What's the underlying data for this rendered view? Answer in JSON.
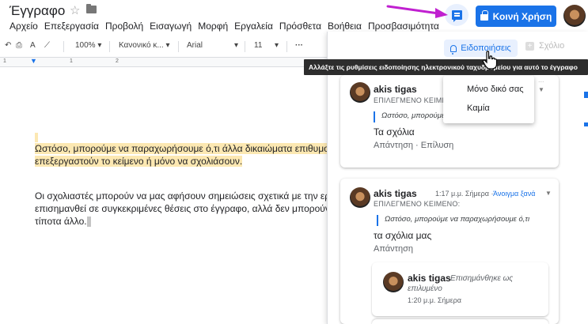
{
  "doc": {
    "title": "Έγγραφο"
  },
  "menu": [
    "Αρχείο",
    "Επεξεργασία",
    "Προβολή",
    "Εισαγωγή",
    "Μορφή",
    "Εργαλεία",
    "Πρόσθετα",
    "Βοήθεια",
    "Προσβασιμότητα"
  ],
  "header": {
    "share_label": "Κοινή Χρήση"
  },
  "toolbar": {
    "zoom": "100%",
    "style": "Κανονικό κ...",
    "font": "Arial",
    "size": "11",
    "more": "···"
  },
  "ruler": {
    "marks": [
      "1",
      "1",
      "2"
    ]
  },
  "document": {
    "para1_line1": "Ωστόσο, μπορούμε να παραχωρήσουμε ό,τι άλλα δικαιώματα επιθυμούμε, ό",
    "para1_line2": "επεξεργαστούν το κείμενο ή μόνο να σχολιάσουν.",
    "para2_line1": "Οι σχολιαστές μπορούν να μας αφήσουν σημειώσεις σχετικά με την εργασία",
    "para2_line2": "επισημανθεί σε συγκεκριμένες θέσεις στο έγγραφο, αλλά δεν μπορούν να επ",
    "para2_line3": "τίποτα άλλο."
  },
  "panel": {
    "notifications_label": "Ειδοποιήσεις",
    "add_label": "Σχόλιο",
    "tooltip": "Αλλάξτε τις ρυθμίσεις ειδοποίησης ηλεκτρονικού ταχυδρομείου για αυτό το έγγραφο",
    "dropdown": [
      "Μόνο δικό σας",
      "Καμία"
    ]
  },
  "comments": [
    {
      "author": "akis tigas",
      "label": "ΕΠΙΛΕΓΜΕΝΟ ΚΕΙΜΕ",
      "time_partial": "...",
      "quote": "Ωστόσο, μπορούμε...",
      "text": "Τα σχόλια",
      "actions": "Απάντηση · Επίλυση"
    },
    {
      "author": "akis tigas",
      "time": "1:17 μ.μ. Σήμερα ·",
      "reopen": "Άνοιγμα ξανά",
      "label": "ΕΠΙΛΕΓΜΕΝΟ ΚΕΙΜΕΝΟ:",
      "quote": "Ωστόσο, μπορούμε να παραχωρήσουμε ό,τι",
      "text": "τα σχόλια μας",
      "actions": "Απάντηση",
      "reply": {
        "author": "akis tigas",
        "status_line1": "Επισημάνθηκε ως",
        "status_line2": "επιλυμένο",
        "time": "1:20 μ.μ. Σήμερα"
      }
    }
  ],
  "colors": {
    "accent": "#1a73e8",
    "highlight": "#fce8b2",
    "annotation_arrow": "#c020d0"
  }
}
